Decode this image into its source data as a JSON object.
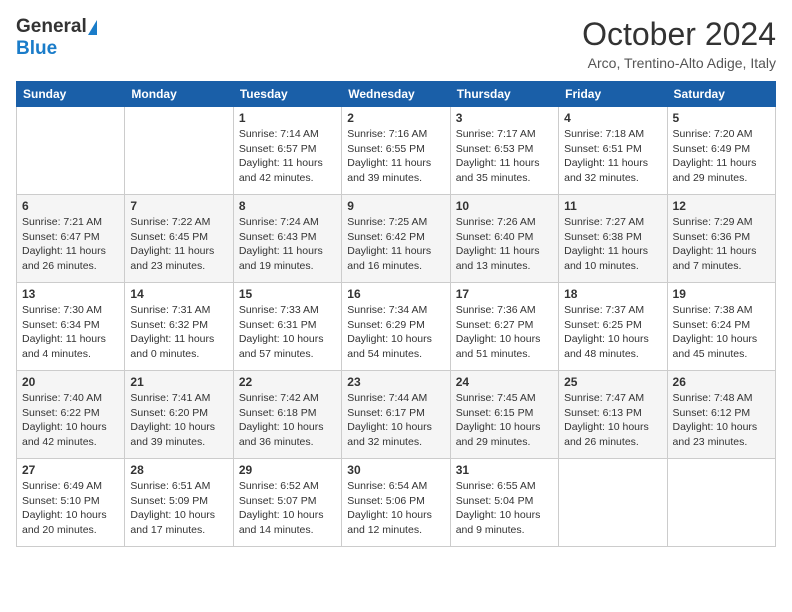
{
  "header": {
    "logo_general": "General",
    "logo_blue": "Blue",
    "month_title": "October 2024",
    "location": "Arco, Trentino-Alto Adige, Italy"
  },
  "weekdays": [
    "Sunday",
    "Monday",
    "Tuesday",
    "Wednesday",
    "Thursday",
    "Friday",
    "Saturday"
  ],
  "weeks": [
    [
      {
        "day": "",
        "info": ""
      },
      {
        "day": "",
        "info": ""
      },
      {
        "day": "1",
        "info": "Sunrise: 7:14 AM\nSunset: 6:57 PM\nDaylight: 11 hours and 42 minutes."
      },
      {
        "day": "2",
        "info": "Sunrise: 7:16 AM\nSunset: 6:55 PM\nDaylight: 11 hours and 39 minutes."
      },
      {
        "day": "3",
        "info": "Sunrise: 7:17 AM\nSunset: 6:53 PM\nDaylight: 11 hours and 35 minutes."
      },
      {
        "day": "4",
        "info": "Sunrise: 7:18 AM\nSunset: 6:51 PM\nDaylight: 11 hours and 32 minutes."
      },
      {
        "day": "5",
        "info": "Sunrise: 7:20 AM\nSunset: 6:49 PM\nDaylight: 11 hours and 29 minutes."
      }
    ],
    [
      {
        "day": "6",
        "info": "Sunrise: 7:21 AM\nSunset: 6:47 PM\nDaylight: 11 hours and 26 minutes."
      },
      {
        "day": "7",
        "info": "Sunrise: 7:22 AM\nSunset: 6:45 PM\nDaylight: 11 hours and 23 minutes."
      },
      {
        "day": "8",
        "info": "Sunrise: 7:24 AM\nSunset: 6:43 PM\nDaylight: 11 hours and 19 minutes."
      },
      {
        "day": "9",
        "info": "Sunrise: 7:25 AM\nSunset: 6:42 PM\nDaylight: 11 hours and 16 minutes."
      },
      {
        "day": "10",
        "info": "Sunrise: 7:26 AM\nSunset: 6:40 PM\nDaylight: 11 hours and 13 minutes."
      },
      {
        "day": "11",
        "info": "Sunrise: 7:27 AM\nSunset: 6:38 PM\nDaylight: 11 hours and 10 minutes."
      },
      {
        "day": "12",
        "info": "Sunrise: 7:29 AM\nSunset: 6:36 PM\nDaylight: 11 hours and 7 minutes."
      }
    ],
    [
      {
        "day": "13",
        "info": "Sunrise: 7:30 AM\nSunset: 6:34 PM\nDaylight: 11 hours and 4 minutes."
      },
      {
        "day": "14",
        "info": "Sunrise: 7:31 AM\nSunset: 6:32 PM\nDaylight: 11 hours and 0 minutes."
      },
      {
        "day": "15",
        "info": "Sunrise: 7:33 AM\nSunset: 6:31 PM\nDaylight: 10 hours and 57 minutes."
      },
      {
        "day": "16",
        "info": "Sunrise: 7:34 AM\nSunset: 6:29 PM\nDaylight: 10 hours and 54 minutes."
      },
      {
        "day": "17",
        "info": "Sunrise: 7:36 AM\nSunset: 6:27 PM\nDaylight: 10 hours and 51 minutes."
      },
      {
        "day": "18",
        "info": "Sunrise: 7:37 AM\nSunset: 6:25 PM\nDaylight: 10 hours and 48 minutes."
      },
      {
        "day": "19",
        "info": "Sunrise: 7:38 AM\nSunset: 6:24 PM\nDaylight: 10 hours and 45 minutes."
      }
    ],
    [
      {
        "day": "20",
        "info": "Sunrise: 7:40 AM\nSunset: 6:22 PM\nDaylight: 10 hours and 42 minutes."
      },
      {
        "day": "21",
        "info": "Sunrise: 7:41 AM\nSunset: 6:20 PM\nDaylight: 10 hours and 39 minutes."
      },
      {
        "day": "22",
        "info": "Sunrise: 7:42 AM\nSunset: 6:18 PM\nDaylight: 10 hours and 36 minutes."
      },
      {
        "day": "23",
        "info": "Sunrise: 7:44 AM\nSunset: 6:17 PM\nDaylight: 10 hours and 32 minutes."
      },
      {
        "day": "24",
        "info": "Sunrise: 7:45 AM\nSunset: 6:15 PM\nDaylight: 10 hours and 29 minutes."
      },
      {
        "day": "25",
        "info": "Sunrise: 7:47 AM\nSunset: 6:13 PM\nDaylight: 10 hours and 26 minutes."
      },
      {
        "day": "26",
        "info": "Sunrise: 7:48 AM\nSunset: 6:12 PM\nDaylight: 10 hours and 23 minutes."
      }
    ],
    [
      {
        "day": "27",
        "info": "Sunrise: 6:49 AM\nSunset: 5:10 PM\nDaylight: 10 hours and 20 minutes."
      },
      {
        "day": "28",
        "info": "Sunrise: 6:51 AM\nSunset: 5:09 PM\nDaylight: 10 hours and 17 minutes."
      },
      {
        "day": "29",
        "info": "Sunrise: 6:52 AM\nSunset: 5:07 PM\nDaylight: 10 hours and 14 minutes."
      },
      {
        "day": "30",
        "info": "Sunrise: 6:54 AM\nSunset: 5:06 PM\nDaylight: 10 hours and 12 minutes."
      },
      {
        "day": "31",
        "info": "Sunrise: 6:55 AM\nSunset: 5:04 PM\nDaylight: 10 hours and 9 minutes."
      },
      {
        "day": "",
        "info": ""
      },
      {
        "day": "",
        "info": ""
      }
    ]
  ]
}
